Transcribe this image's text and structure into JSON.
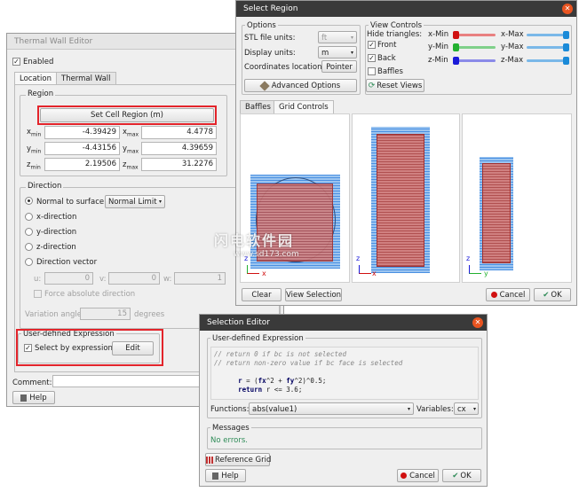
{
  "thermal_wall_editor": {
    "title": "Thermal Wall Editor",
    "enabled_label": "Enabled",
    "tabs": [
      "Location",
      "Thermal Wall"
    ],
    "region_title": "Region",
    "set_cell_region_label": "Set Cell Region (m)",
    "xmin_label": "x",
    "xmin_sub": "min",
    "xmin_value": "-4.39429",
    "xmax_label": "x",
    "xmax_sub": "max",
    "xmax_value": "4.4778",
    "ymin_label": "y",
    "ymin_sub": "min",
    "ymin_value": "-4.43156",
    "ymax_label": "y",
    "ymax_sub": "max",
    "ymax_value": "4.39659",
    "zmin_label": "z",
    "zmin_sub": "min",
    "zmin_value": "2.19506",
    "zmax_label": "z",
    "zmax_sub": "max",
    "zmax_value": "31.2276",
    "direction_title": "Direction",
    "normal_to_surface_label": "Normal to surface:",
    "normal_limit_value": "Normal Limit",
    "x_direction": "x-direction",
    "y_direction": "y-direction",
    "z_direction": "z-direction",
    "direction_vector": "Direction vector",
    "u_label": "u:",
    "u_value": "0",
    "v_label": "v:",
    "v_value": "0",
    "w_label": "w:",
    "w_value": "1",
    "force_absolute_label": "Force absolute direction",
    "variation_angle_label": "Variation angle",
    "variation_angle_value": "15",
    "degrees_label": "degrees",
    "user_expr_title": "User-defined Expression",
    "select_by_expr_label": "Select by expression",
    "edit_label": "Edit",
    "comment_label": "Comment:",
    "help_label": "Help"
  },
  "select_region": {
    "title": "Select Region",
    "options_title": "Options",
    "stl_units_label": "STL file units:",
    "stl_units_value": "ft",
    "display_units_label": "Display units:",
    "display_units_value": "m",
    "coord_location_label": "Coordinates location:",
    "pointer_label": "Pointer",
    "advanced_options_label": "Advanced Options",
    "view_controls_title": "View Controls",
    "hide_triangles_label": "Hide triangles:",
    "front_label": "Front",
    "back_label": "Back",
    "baffles_label": "Baffles",
    "reset_views_label": "Reset Views",
    "xmin_slider": "x-Min",
    "xmax_slider": "x-Max",
    "ymin_slider": "y-Min",
    "ymax_slider": "y-Max",
    "zmin_slider": "z-Min",
    "zmax_slider": "z-Max",
    "tabs": [
      "Baffles",
      "Grid Controls"
    ],
    "axis_x": "x",
    "axis_y": "y",
    "axis_z": "z",
    "clear_label": "Clear",
    "view_selection_label": "View Selection",
    "cancel_label": "Cancel",
    "ok_label": "OK"
  },
  "selection_editor": {
    "title": "Selection Editor",
    "user_expr_title": "User-defined Expression",
    "code_line1": "// return 0 if bc is not selected",
    "code_line2": "// return non-zero value if bc face is selected",
    "code_line3_a": "r",
    "code_line3_b": " = (",
    "code_line3_c": "fx",
    "code_line3_d": "^2 + ",
    "code_line3_e": "fy",
    "code_line3_f": "^2)^0.5;",
    "code_line4_a": "return",
    "code_line4_b": " r <= 3.6;",
    "functions_label": "Functions:",
    "functions_value": "abs(value1)",
    "variables_label": "Variables:",
    "variables_value": "cx",
    "messages_title": "Messages",
    "messages_text": "No errors.",
    "reference_grid_label": "Reference Grid",
    "help_label": "Help",
    "cancel_label": "Cancel",
    "ok_label": "OK"
  },
  "watermark": {
    "text1": "闪电软件园",
    "text2": "www.sd173.com"
  },
  "colors": {
    "title_active": "#3a3a3a",
    "close_orange": "#e95420",
    "highlight_red": "#e3242b",
    "mesh_blue": "#4a90e2",
    "mesh_red": "#c0504d",
    "ok_green": "#2e8b57"
  }
}
